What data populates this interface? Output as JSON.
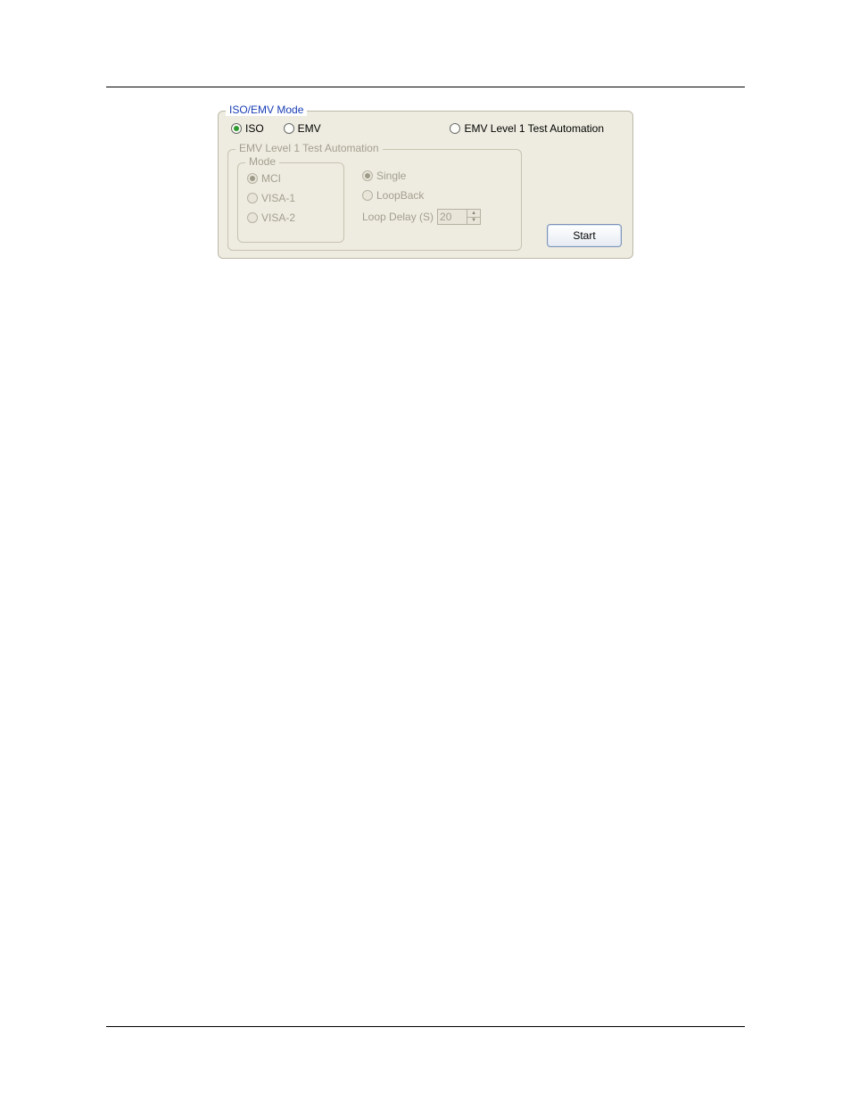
{
  "panel": {
    "legend": "ISO/EMV Mode",
    "mode_options": {
      "iso": "ISO",
      "emv": "EMV",
      "emv_auto": "EMV Level 1 Test Automation"
    },
    "inner": {
      "legend": "EMV Level 1 Test Automation",
      "mode_legend": "Mode",
      "mode": {
        "mci": "MCI",
        "visa1": "VISA-1",
        "visa2": "VISA-2"
      },
      "run": {
        "single": "Single",
        "loopback": "LoopBack",
        "loop_delay_label": "Loop Delay (S)",
        "loop_delay_value": "20"
      }
    },
    "start_label": "Start"
  }
}
